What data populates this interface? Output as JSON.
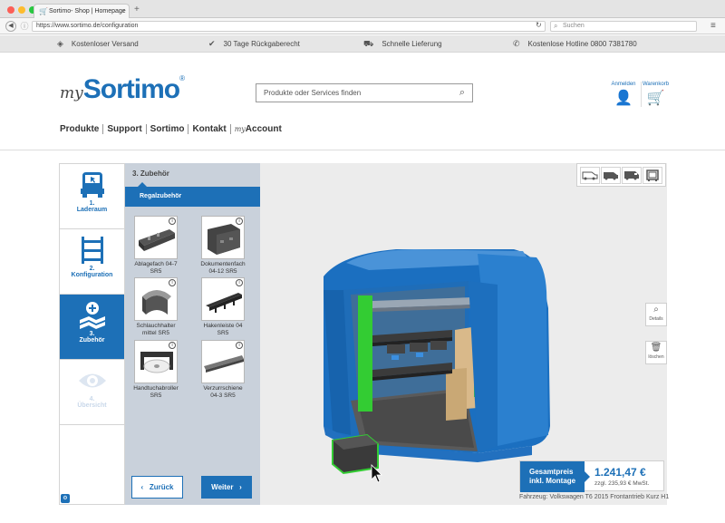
{
  "browser": {
    "tab_title": "Sortimo- Shop | Homepage",
    "url": "https://www.sortimo.de/configuration",
    "search_placeholder": "Suchen"
  },
  "usp": [
    {
      "icon": "box-icon",
      "label": "Kostenloser Versand"
    },
    {
      "icon": "check-icon",
      "label": "30 Tage Rückgaberecht"
    },
    {
      "icon": "truck-icon",
      "label": "Schnelle Lieferung"
    },
    {
      "icon": "phone-icon",
      "label": "Kostenlose Hotline 0800 7381780"
    }
  ],
  "header": {
    "logo_prefix": "my",
    "logo_main": "Sortimo",
    "logo_reg": "®",
    "search_placeholder": "Produkte oder Services finden",
    "account_label": "Anmelden",
    "cart_label": "Warenkorb"
  },
  "nav": {
    "items": [
      "Produkte",
      "Support",
      "Sortimo",
      "Kontakt"
    ],
    "account_prefix": "my",
    "account_label": "Account"
  },
  "steps": [
    {
      "number": "1.",
      "label": "Laderaum",
      "state": "done"
    },
    {
      "number": "2.",
      "label": "Konfiguration",
      "state": "done"
    },
    {
      "number": "3.",
      "label": "Zubehör",
      "state": "active"
    },
    {
      "number": "4.",
      "label": "Übersicht",
      "state": "disabled"
    }
  ],
  "accessories": {
    "title": "3. Zubehör",
    "category": "Regalzubehör",
    "products": [
      {
        "line1": "Ablagefach 04-7",
        "line2": "SR5"
      },
      {
        "line1": "Dokumentenfach",
        "line2": "04-12 SR5"
      },
      {
        "line1": "Schlauchhalter",
        "line2": "mittel SR5"
      },
      {
        "line1": "Hakenleiste 04",
        "line2": "SR5"
      },
      {
        "line1": "Handtuchabroller",
        "line2": "SR5"
      },
      {
        "line1": "Verzurrschiene",
        "line2": "04-3 SR5"
      }
    ],
    "info_glyph": "i"
  },
  "buttons": {
    "back": "Zurück",
    "next": "Weiter"
  },
  "viewer": {
    "tools": [
      {
        "label": "Details",
        "icon": "magnifier-icon"
      },
      {
        "label": "löschen",
        "icon": "trash-icon"
      }
    ]
  },
  "price": {
    "label_line1": "Gesamtpreis",
    "label_line2": "inkl. Montage",
    "total": "1.241,47 €",
    "vat": "zzgl. 235,93 € MwSt."
  },
  "vehicle": "Fahrzeug: Volkswagen T6 2015 Frontantrieb Kurz H1",
  "colors": {
    "brand_blue": "#1d70b7",
    "accent_green": "#33cc33"
  }
}
